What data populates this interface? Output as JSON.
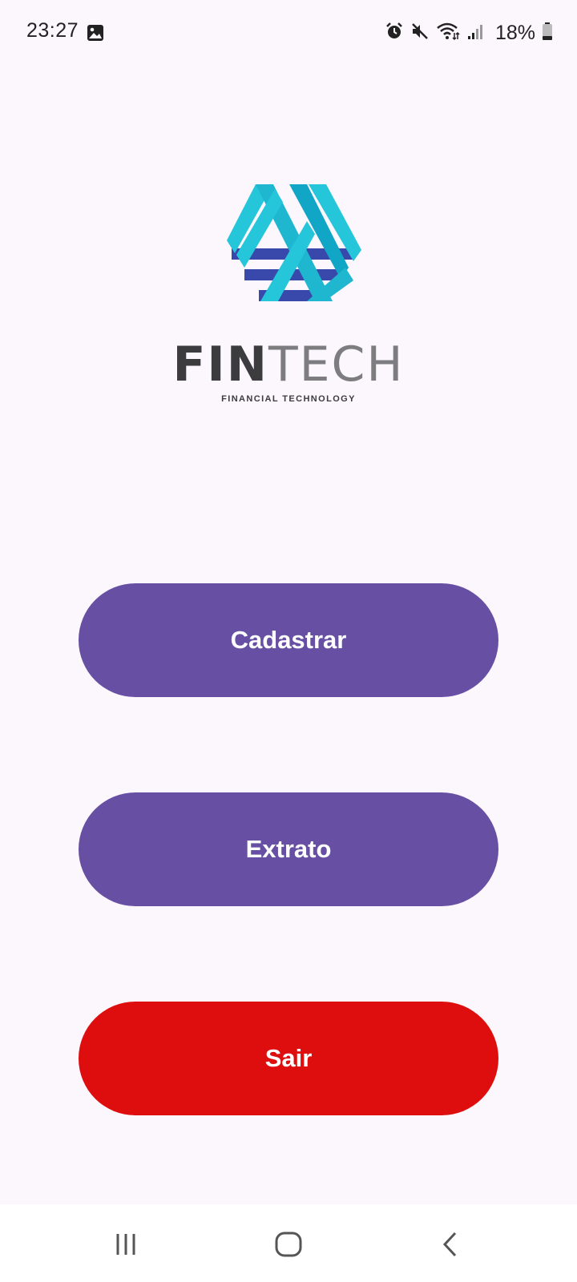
{
  "status_bar": {
    "time": "23:27",
    "battery": "18%",
    "icons": [
      "image-icon",
      "alarm-icon",
      "mute-icon",
      "wifi-icon",
      "signal-icon",
      "battery-icon"
    ]
  },
  "logo": {
    "wordmark_part1": "FIN",
    "wordmark_part2": "TECH",
    "tagline": "FINANCIAL TECHNOLOGY"
  },
  "buttons": {
    "cadastrar": "Cadastrar",
    "extrato": "Extrato",
    "sair": "Sair"
  },
  "nav_bar": {
    "icons": [
      "recents-icon",
      "home-icon",
      "back-icon"
    ]
  },
  "colors": {
    "background": "#fcf6fd",
    "primary_button": "#6750a4",
    "exit_button": "#de0e0e",
    "logo_cyan": "#26c6da",
    "logo_blue": "#3f51b5"
  }
}
